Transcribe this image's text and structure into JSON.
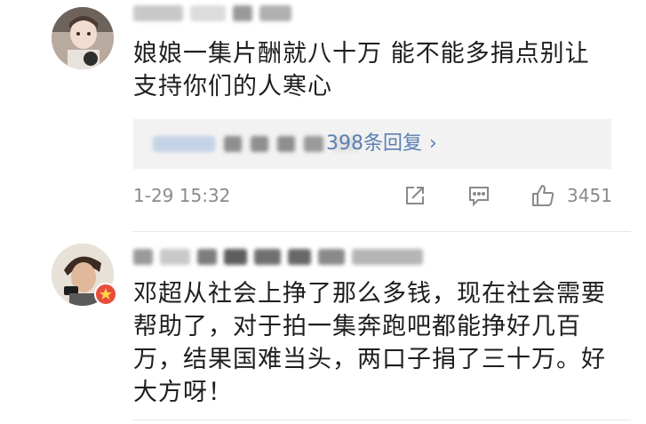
{
  "comments": [
    {
      "text": "娘娘一集片酬就八十万 能不能多捐点别让支持你们的人寒心",
      "reply_link": "398条回复",
      "reply_chevron": "›",
      "time": "1-29 15:32",
      "likes": "3451",
      "icons": [
        "share-icon",
        "comment-icon",
        "like-icon"
      ]
    },
    {
      "text": "邓超从社会上挣了那么多钱，现在社会需要帮助了，对于拍一集奔跑吧都能挣好几百万，结果国难当头，两口子捐了三十万。好大方呀！",
      "badge_icon": "verified-badge-icon"
    }
  ],
  "colors": {
    "reply_link": "#5b7fb1",
    "meta": "#8a8a8a",
    "reply_bg": "#f2f2f2",
    "badge": "#e74c3c"
  }
}
